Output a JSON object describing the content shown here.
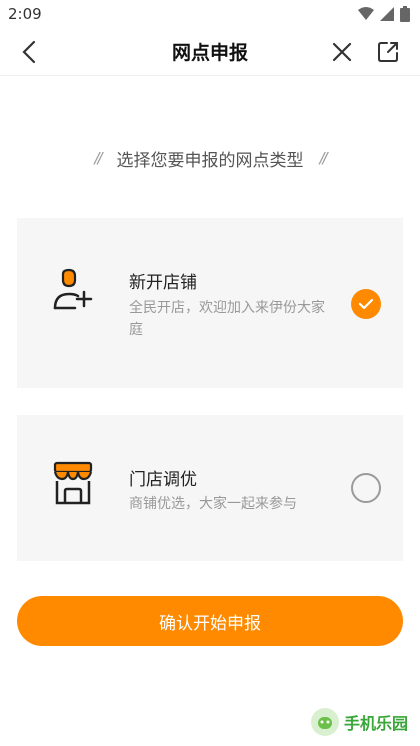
{
  "status_bar": {
    "time": "2:09",
    "wifi_icon": "wifi-icon",
    "signal_icon": "signal-icon",
    "battery_icon": "battery-icon"
  },
  "nav": {
    "title": "网点申报",
    "back_icon": "back-arrow-icon",
    "close_icon": "close-icon",
    "share_icon": "share-icon"
  },
  "heading": {
    "text": "选择您要申报的网点类型",
    "decor_left": "//",
    "decor_right": "//"
  },
  "options": [
    {
      "title": "新开店铺",
      "description": "全民开店，欢迎加入来伊份大家庭",
      "icon": "add-user-icon",
      "selected": true
    },
    {
      "title": "门店调优",
      "description": "商铺优选，大家一起来参与",
      "icon": "store-icon",
      "selected": false
    }
  ],
  "confirm_button": {
    "label": "确认开始申报"
  },
  "watermark": {
    "text": "手机乐园",
    "icon": "android-robot-icon"
  },
  "colors": {
    "accent": "#ff8a00",
    "card_bg": "#f6f6f6",
    "desc_text": "#999999"
  }
}
